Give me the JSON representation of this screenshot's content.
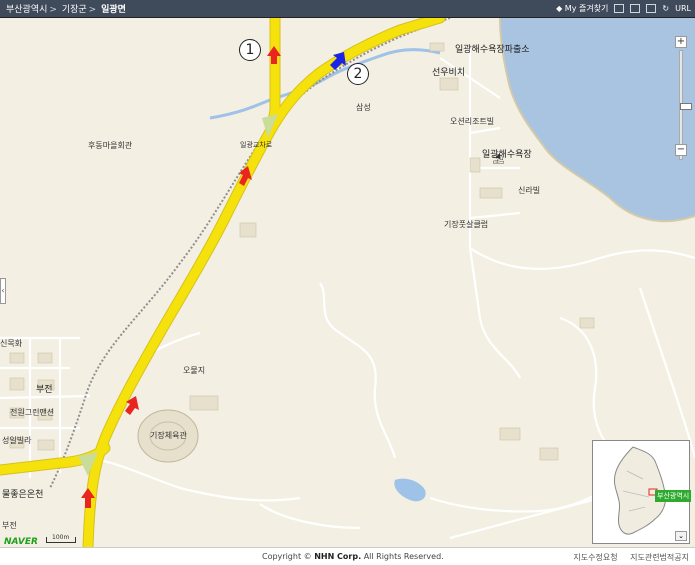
{
  "breadcrumb": {
    "items": [
      "부산광역시",
      "기장군",
      "일광면"
    ],
    "separators": [
      ">",
      ">"
    ]
  },
  "toolbar": {
    "favorites_label": "My 즐겨찾기",
    "url_label": "URL",
    "icons": [
      "star-icon",
      "print-icon",
      "save-icon",
      "screen-icon",
      "refresh-icon",
      "url-icon"
    ]
  },
  "markers": {
    "marker_1": "1",
    "marker_2": "2"
  },
  "places": {
    "ilgwang_beach_police": "일광해수욕장파출소",
    "seonu_villa": "선우비치",
    "samseong": "삼성",
    "ocean_resort": "오션리조트빌",
    "ilgwang_beach": "일광해수욕장",
    "silla_villa": "신라빌",
    "gijang_sports_club": "기장풋살클럽",
    "hudong_hall": "후동마을회관",
    "ilgwang_ic": "일광교차로",
    "oljji": "오물지",
    "gijang_gym": "기장체육관",
    "sinmokhwa": "신목화",
    "bujeon_1": "부전",
    "jeonwon_green": "전원그린맨션",
    "seongil_villa": "성일빌라",
    "mulgoleun": "물좋은온천",
    "bujeon_2": "부전"
  },
  "minimap": {
    "tag": "부산광역시"
  },
  "scale_label": "100m",
  "logo_text": "NAVER",
  "footer": {
    "copyright_prefix": "Copyright ©",
    "company": "NHN Corp.",
    "copyright_suffix": "All Rights Reserved.",
    "link1": "지도수정요청",
    "link2": "지도관련법적공지"
  },
  "colors": {
    "sea": "#a8c4e0",
    "land": "#f3efe3",
    "road_main": "#f5e20c",
    "road_minor": "#ffffff",
    "river": "#9fc2e8",
    "arrow_red": "#e8251f",
    "arrow_blue": "#1a23e6",
    "topbar": "#3f4a5a"
  }
}
